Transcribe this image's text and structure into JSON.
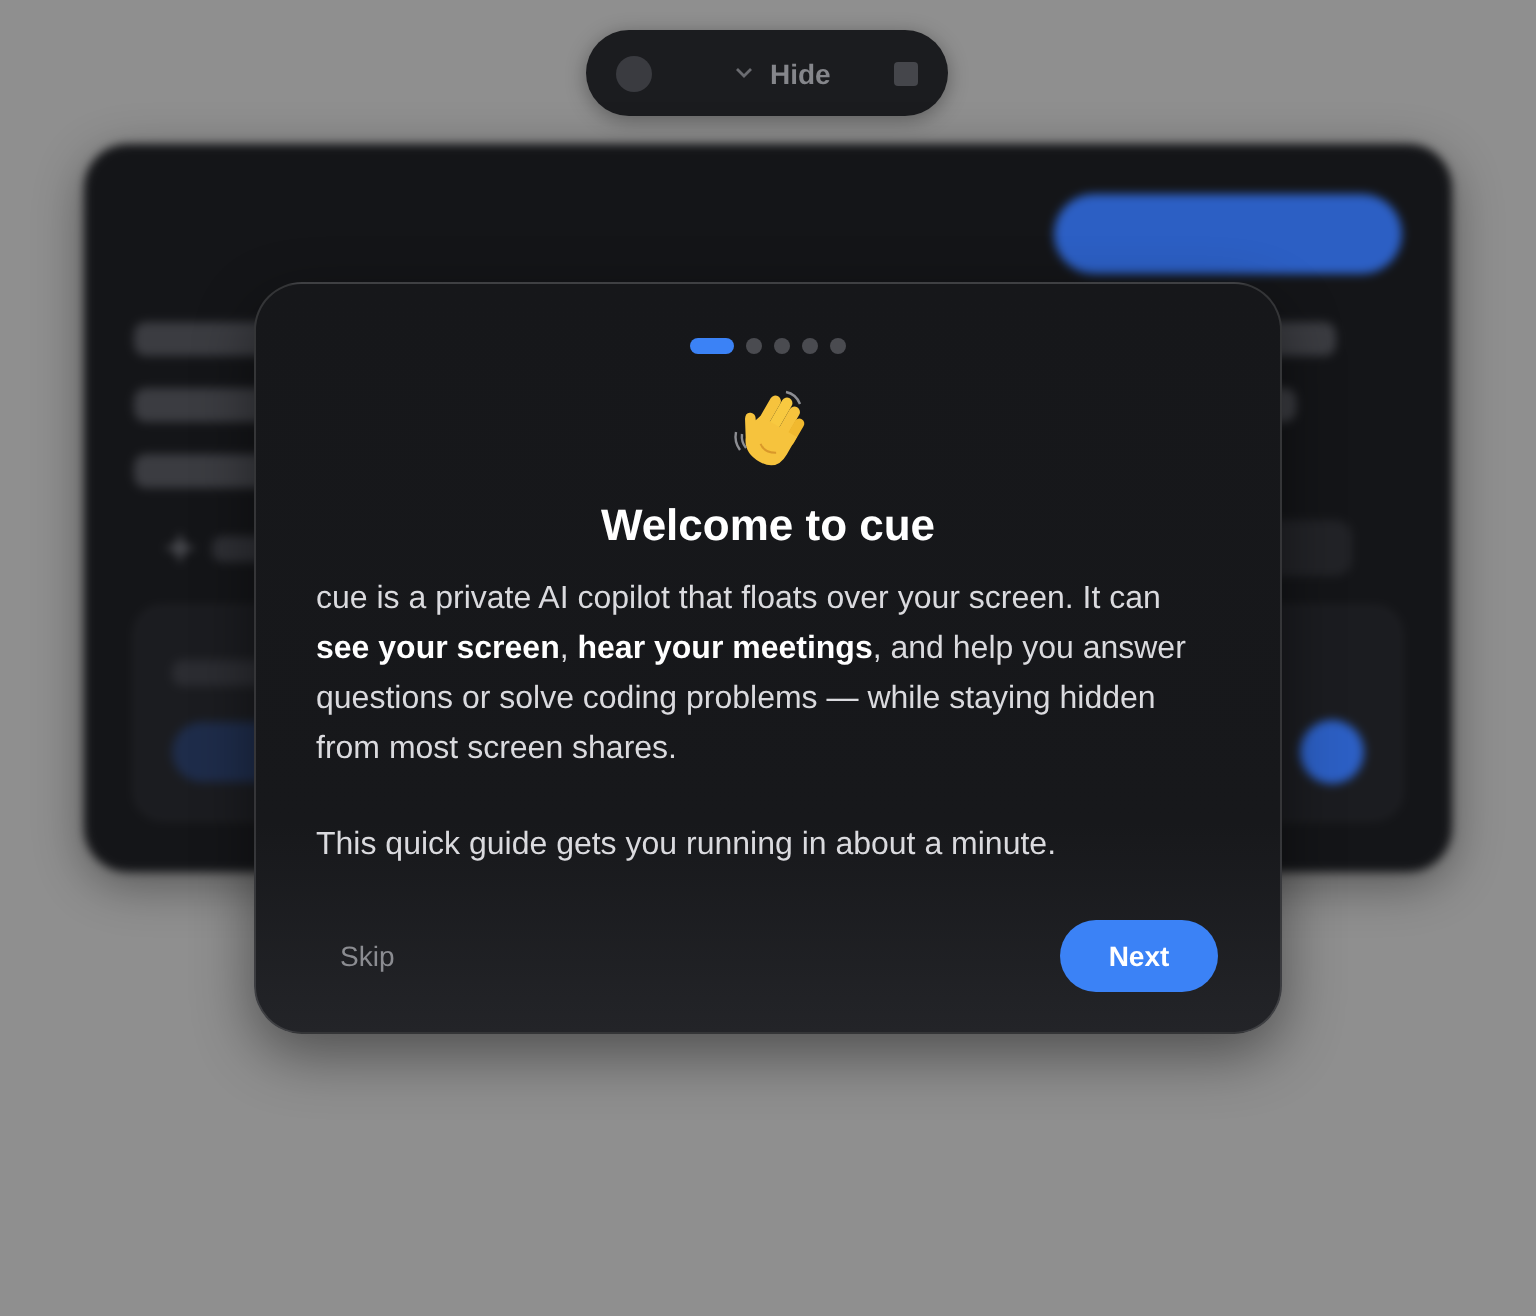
{
  "toolbar": {
    "hide_label": "Hide"
  },
  "modal": {
    "steps": [
      {
        "selected": true
      },
      {
        "selected": false
      },
      {
        "selected": false
      },
      {
        "selected": false
      },
      {
        "selected": false
      }
    ],
    "title": "Welcome to cue",
    "paragraphs": [
      "cue is a private AI copilot that floats over your screen. It can **see your screen**, **hear your meetings**, and help you answer questions or solve coding problems — while staying hidden from most screen shares.",
      "This quick guide gets you running in about a minute."
    ],
    "skip_label": "Skip",
    "next_label": "Next"
  }
}
